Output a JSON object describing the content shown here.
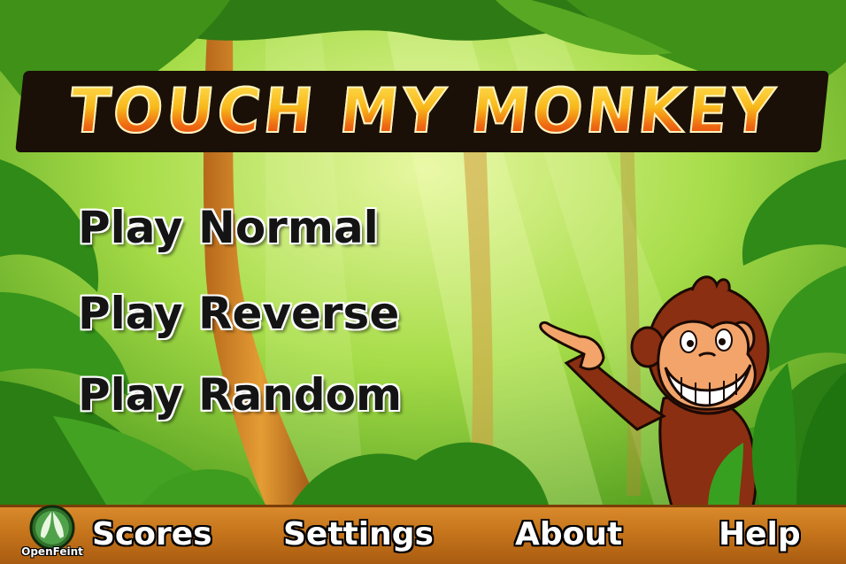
{
  "game": {
    "title": "TOUCH MY MONKEY"
  },
  "menu": {
    "play_normal": "Play Normal",
    "play_reverse": "Play Reverse",
    "play_random": "Play Random"
  },
  "bottom_bar": {
    "scores": "Scores",
    "settings": "Settings",
    "about": "About",
    "help": "Help",
    "openfeint_label": "OpenFeint"
  },
  "colors": {
    "jungle": "#8fd23a",
    "bar": "#c7761c",
    "title_top": "#ffe55c",
    "title_bottom": "#e2300e"
  }
}
